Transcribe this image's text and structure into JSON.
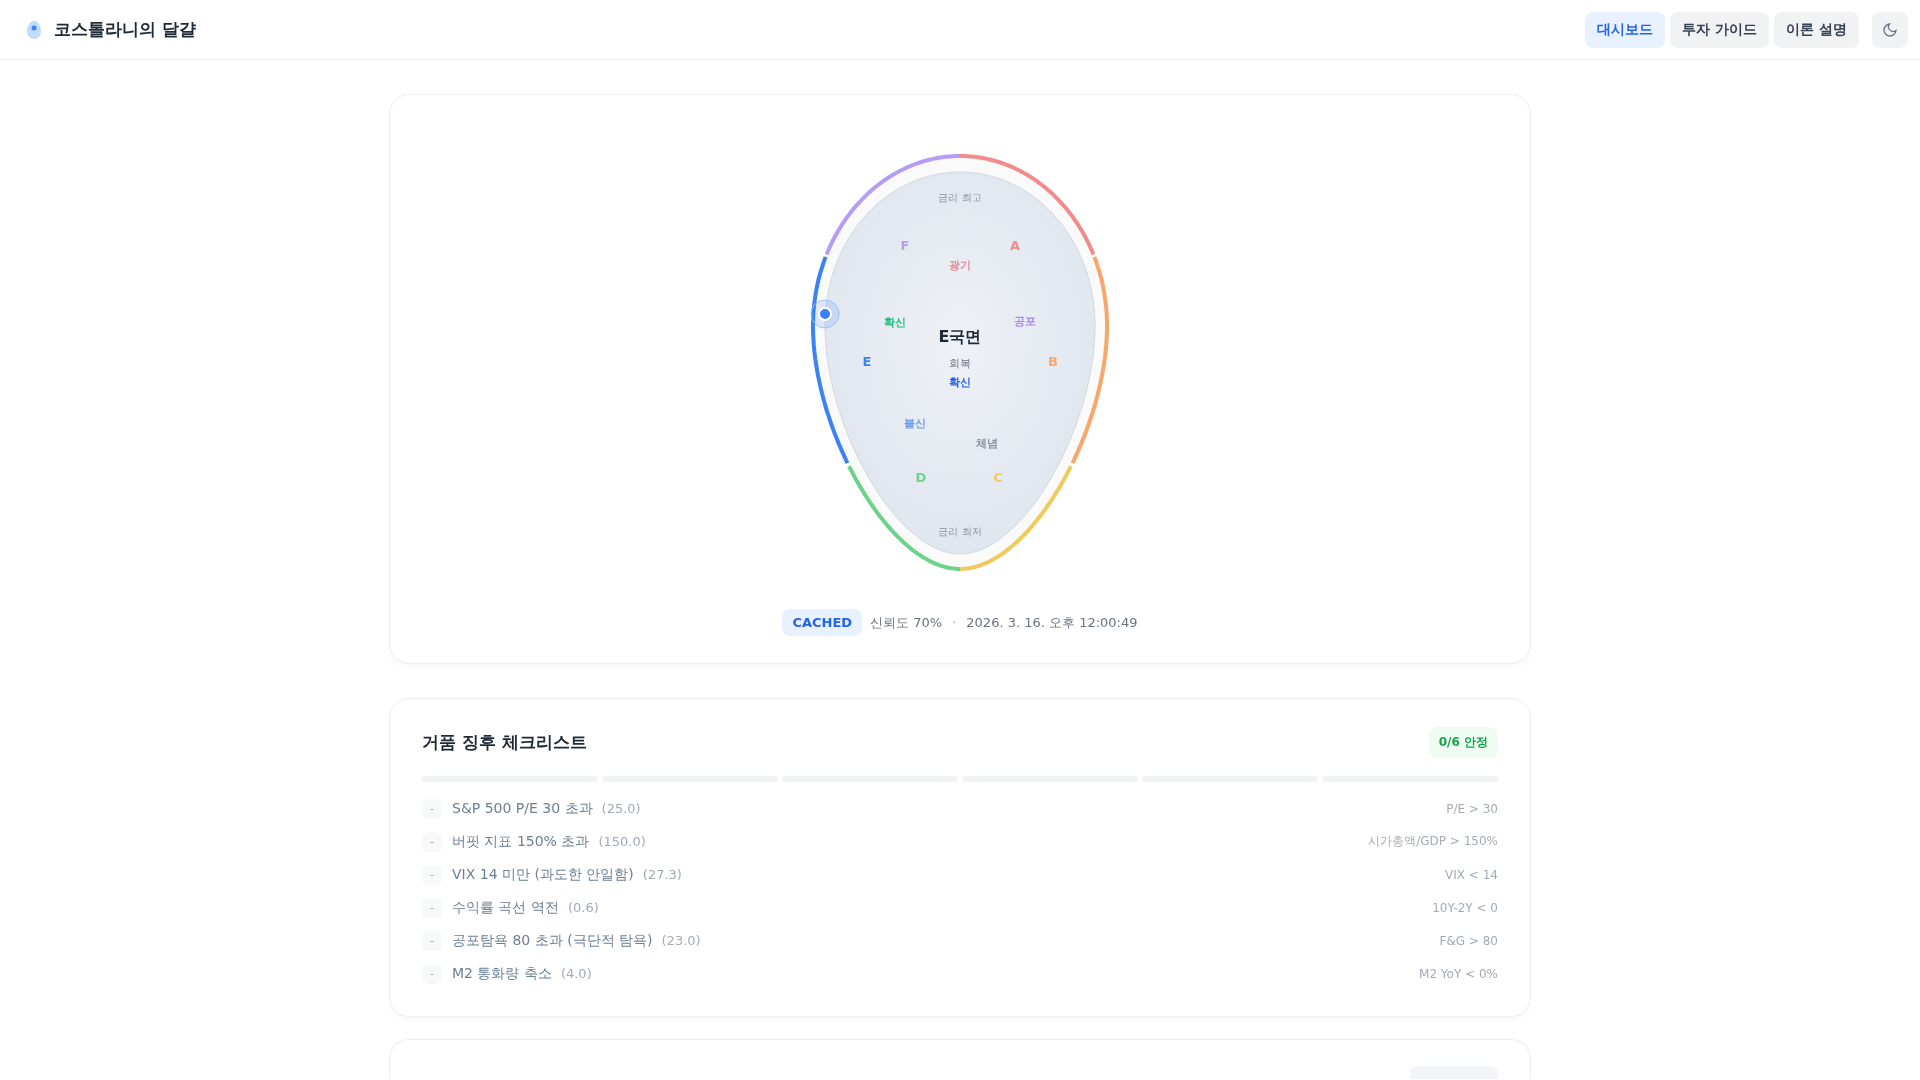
{
  "header": {
    "title": "코스톨라니의 달걀",
    "nav": [
      {
        "label": "대시보드",
        "selected": true
      },
      {
        "label": "투자 가이드",
        "selected": false
      },
      {
        "label": "이론 설명",
        "selected": false
      }
    ]
  },
  "egg": {
    "top_label": "금리 최고",
    "bottom_label": "금리 최저",
    "phase": "E국면",
    "stage": "회복",
    "mood": "확신",
    "phases": [
      {
        "letter": "A",
        "color": "#f28b8b"
      },
      {
        "letter": "B",
        "color": "#f9a66c"
      },
      {
        "letter": "C",
        "color": "#eecb5c"
      },
      {
        "letter": "D",
        "color": "#6dd38b"
      },
      {
        "letter": "E",
        "color": "#3b82f6"
      },
      {
        "letter": "F",
        "color": "#b49cf7"
      }
    ],
    "emotions": [
      {
        "label": "광기",
        "color": "#e68a90"
      },
      {
        "label": "공포",
        "color": "#a98ae6"
      },
      {
        "label": "체념",
        "color": "#8a919c"
      },
      {
        "label": "불신",
        "color": "#6f9be6"
      },
      {
        "label": "확신",
        "color": "#22c07a"
      }
    ]
  },
  "status": {
    "source": "CACHED",
    "confidence": "신뢰도 70%",
    "separator": "·",
    "timestamp": "2026. 3. 16. 오후 12:00:49"
  },
  "checklist": {
    "title": "거품 징후 체크리스트",
    "badge": "0/6 안정",
    "items": [
      {
        "marker": "-",
        "label": "S&P 500 P/E 30 초과",
        "value": "(25.0)",
        "threshold": "P/E > 30",
        "checked": false
      },
      {
        "marker": "-",
        "label": "버핏 지표 150% 초과",
        "value": "(150.0)",
        "threshold": "시가총액/GDP > 150%",
        "checked": false
      },
      {
        "marker": "-",
        "label": "VIX 14 미만 (과도한 안일함)",
        "value": "(27.3)",
        "threshold": "VIX < 14",
        "checked": false
      },
      {
        "marker": "-",
        "label": "수익률 곡선 역전",
        "value": "(0.6)",
        "threshold": "10Y-2Y < 0",
        "checked": false
      },
      {
        "marker": "-",
        "label": "공포탐욕 80 초과 (극단적 탐욕)",
        "value": "(23.0)",
        "threshold": "F&G > 80",
        "checked": false
      },
      {
        "marker": "-",
        "label": "M2 통화량 축소",
        "value": "(4.0)",
        "threshold": "M2 YoY < 0%",
        "checked": false
      }
    ]
  }
}
